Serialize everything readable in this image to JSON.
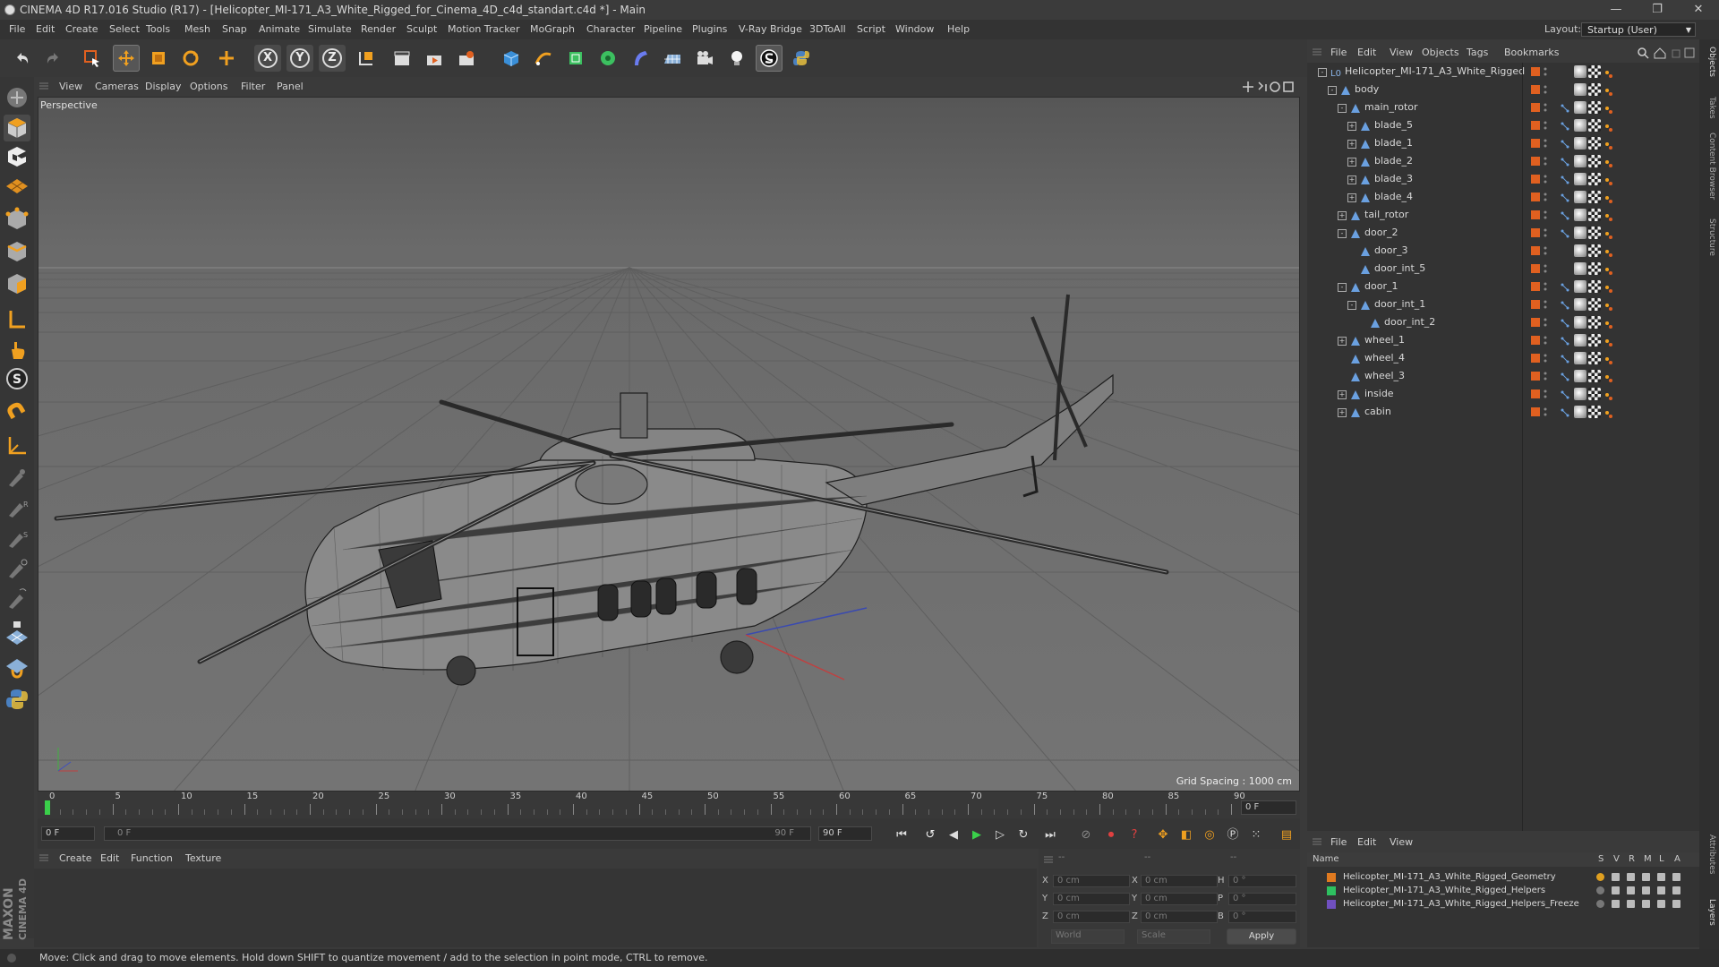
{
  "window": {
    "title": "CINEMA 4D R17.016 Studio (R17) - [Helicopter_MI-171_A3_White_Rigged_for_Cinema_4D_c4d_standart.c4d *] - Main",
    "controls": [
      "—",
      "❐",
      "✕"
    ]
  },
  "menubar": {
    "items": [
      "File",
      "Edit",
      "Create",
      "Select",
      "Tools",
      "Mesh",
      "Snap",
      "Animate",
      "Simulate",
      "Render",
      "Sculpt",
      "Motion Tracker",
      "MoGraph",
      "Character",
      "Pipeline",
      "Plugins",
      "V-Ray Bridge",
      "3DToAll",
      "Script",
      "Window",
      "Help"
    ],
    "layout_label": "Layout:",
    "layout_value": "Startup (User)"
  },
  "toolbar": {
    "axis": [
      "X",
      "Y",
      "Z"
    ]
  },
  "viewport": {
    "menu": [
      "View",
      "Cameras",
      "Display",
      "Options",
      "Filter",
      "Panel"
    ],
    "label": "Perspective",
    "grid_spacing": "Grid Spacing : 1000 cm"
  },
  "timeline": {
    "ticks": [
      "0",
      "5",
      "10",
      "15",
      "20",
      "25",
      "30",
      "35",
      "40",
      "45",
      "50",
      "55",
      "60",
      "65",
      "70",
      "75",
      "80",
      "85",
      "90"
    ],
    "current_frame": "0 F"
  },
  "transport": {
    "start_field": "0 F",
    "range_start": "0 F",
    "range_end": "90 F",
    "end_field": "90 F"
  },
  "material_manager": {
    "menu": [
      "Create",
      "Edit",
      "Function",
      "Texture"
    ]
  },
  "coordinates": {
    "header": [
      "--",
      "--",
      "--"
    ],
    "rows": [
      {
        "l1": "X",
        "v1": "0 cm",
        "l2": "X",
        "v2": "0 cm",
        "l3": "H",
        "v3": "0 °"
      },
      {
        "l1": "Y",
        "v1": "0 cm",
        "l2": "Y",
        "v2": "0 cm",
        "l3": "P",
        "v3": "0 °"
      },
      {
        "l1": "Z",
        "v1": "0 cm",
        "l2": "Z",
        "v2": "0 cm",
        "l3": "B",
        "v3": "0 °"
      }
    ],
    "mode_world": "World",
    "mode_scale": "Scale",
    "apply": "Apply"
  },
  "object_manager": {
    "menu": [
      "File",
      "Edit",
      "View",
      "Objects",
      "Tags",
      "Bookmarks"
    ],
    "objects": [
      {
        "name": "Helicopter_MI-171_A3_White_Rigged",
        "depth": 0,
        "exp": "-"
      },
      {
        "name": "body",
        "depth": 1,
        "exp": "-"
      },
      {
        "name": "main_rotor",
        "depth": 2,
        "exp": "-"
      },
      {
        "name": "blade_5",
        "depth": 3,
        "exp": "+"
      },
      {
        "name": "blade_1",
        "depth": 3,
        "exp": "+"
      },
      {
        "name": "blade_2",
        "depth": 3,
        "exp": "+"
      },
      {
        "name": "blade_3",
        "depth": 3,
        "exp": "+"
      },
      {
        "name": "blade_4",
        "depth": 3,
        "exp": "+"
      },
      {
        "name": "tail_rotor",
        "depth": 2,
        "exp": "+"
      },
      {
        "name": "door_2",
        "depth": 2,
        "exp": "-"
      },
      {
        "name": "door_3",
        "depth": 3,
        "exp": ""
      },
      {
        "name": "door_int_5",
        "depth": 3,
        "exp": ""
      },
      {
        "name": "door_1",
        "depth": 2,
        "exp": "-"
      },
      {
        "name": "door_int_1",
        "depth": 3,
        "exp": "-"
      },
      {
        "name": "door_int_2",
        "depth": 4,
        "exp": ""
      },
      {
        "name": "wheel_1",
        "depth": 2,
        "exp": "+"
      },
      {
        "name": "wheel_4",
        "depth": 2,
        "exp": ""
      },
      {
        "name": "wheel_3",
        "depth": 2,
        "exp": ""
      },
      {
        "name": "inside",
        "depth": 2,
        "exp": "+"
      },
      {
        "name": "cabin",
        "depth": 2,
        "exp": "+"
      }
    ]
  },
  "layer_manager": {
    "menu": [
      "File",
      "Edit",
      "View"
    ],
    "columns": [
      "Name",
      "S",
      "V",
      "R",
      "M",
      "L",
      "A"
    ],
    "layers": [
      {
        "name": "Helicopter_MI-171_A3_White_Rigged_Geometry",
        "color": "#e07a20"
      },
      {
        "name": "Helicopter_MI-171_A3_White_Rigged_Helpers",
        "color": "#2ec060"
      },
      {
        "name": "Helicopter_MI-171_A3_White_Rigged_Helpers_Freeze",
        "color": "#7050c0"
      }
    ]
  },
  "right_tabs": [
    "Objects",
    "Takes",
    "Content Browser",
    "Structure",
    "Attributes",
    "Layers"
  ],
  "brand": {
    "line1": "MAXON",
    "line2": "CINEMA 4D"
  },
  "status": "Move: Click and drag to move elements. Hold down SHIFT to quantize movement / add to the selection in point mode, CTRL to remove.",
  "colors": {
    "accent": "#e06020",
    "timeline_marker": "#3ad04a"
  }
}
